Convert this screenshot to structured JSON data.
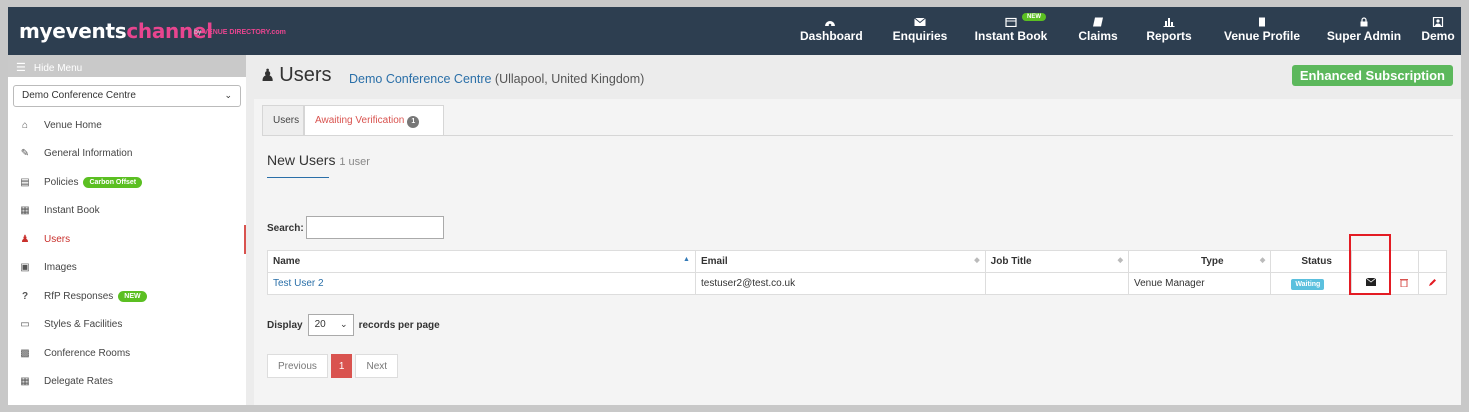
{
  "brand": {
    "main_a": "myevents",
    "main_b": "channel",
    "by": "by",
    "sub": "VENUE DIRECTORY.com"
  },
  "nav": [
    {
      "label": "Dashboard",
      "icon": "dashboard-icon"
    },
    {
      "label": "Enquiries",
      "icon": "envelope-icon"
    },
    {
      "label": "Instant Book",
      "icon": "calendar-icon",
      "badge": "NEW"
    },
    {
      "label": "Claims",
      "icon": "book-icon"
    },
    {
      "label": "Reports",
      "icon": "bar-chart-icon"
    },
    {
      "label": "Venue Profile",
      "icon": "building-icon"
    },
    {
      "label": "Super Admin",
      "icon": "lock-icon"
    },
    {
      "label": "Demo",
      "icon": "user-square-icon"
    }
  ],
  "sidebar": {
    "hide_menu": "Hide Menu",
    "venue_select": "Demo Conference Centre",
    "items": [
      {
        "label": "Venue Home",
        "icon": "home-icon"
      },
      {
        "label": "General Information",
        "icon": "edit-icon"
      },
      {
        "label": "Policies",
        "icon": "document-icon",
        "pill": "Carbon Offset"
      },
      {
        "label": "Instant Book",
        "icon": "calendar-icon"
      },
      {
        "label": "Users",
        "icon": "user-icon",
        "active": true
      },
      {
        "label": "Images",
        "icon": "image-icon"
      },
      {
        "label": "RfP Responses",
        "icon": "question-icon",
        "pill": "NEW"
      },
      {
        "label": "Styles & Facilities",
        "icon": "monitor-icon"
      },
      {
        "label": "Conference Rooms",
        "icon": "briefcase-icon"
      },
      {
        "label": "Delegate Rates",
        "icon": "calculator-icon"
      }
    ]
  },
  "header": {
    "title": "Users",
    "venue": "Demo Conference Centre",
    "location": "(Ullapool, United Kingdom)",
    "subscription": "Enhanced Subscription"
  },
  "tabs": {
    "users": "Users",
    "awaiting": "Awaiting Verification",
    "awaiting_count": "1"
  },
  "section": {
    "title": "New Users",
    "count": "1 user"
  },
  "search": {
    "label": "Search:",
    "value": ""
  },
  "table": {
    "headers": [
      "Name",
      "Email",
      "Job Title",
      "Type",
      "Status"
    ],
    "rows": [
      {
        "name": "Test User 2",
        "email": "testuser2@test.co.uk",
        "job_title": "",
        "type": "Venue Manager",
        "status": "Waiting"
      }
    ]
  },
  "display": {
    "prefix": "Display",
    "value": "20",
    "suffix": "records per page"
  },
  "pager": {
    "previous": "Previous",
    "current": "1",
    "next": "Next"
  },
  "colors": {
    "nav_bg": "#2d3e50",
    "accent_red": "#d9534f",
    "green": "#5cb85c",
    "link": "#2a6fa8",
    "waiting": "#5bc0de"
  }
}
